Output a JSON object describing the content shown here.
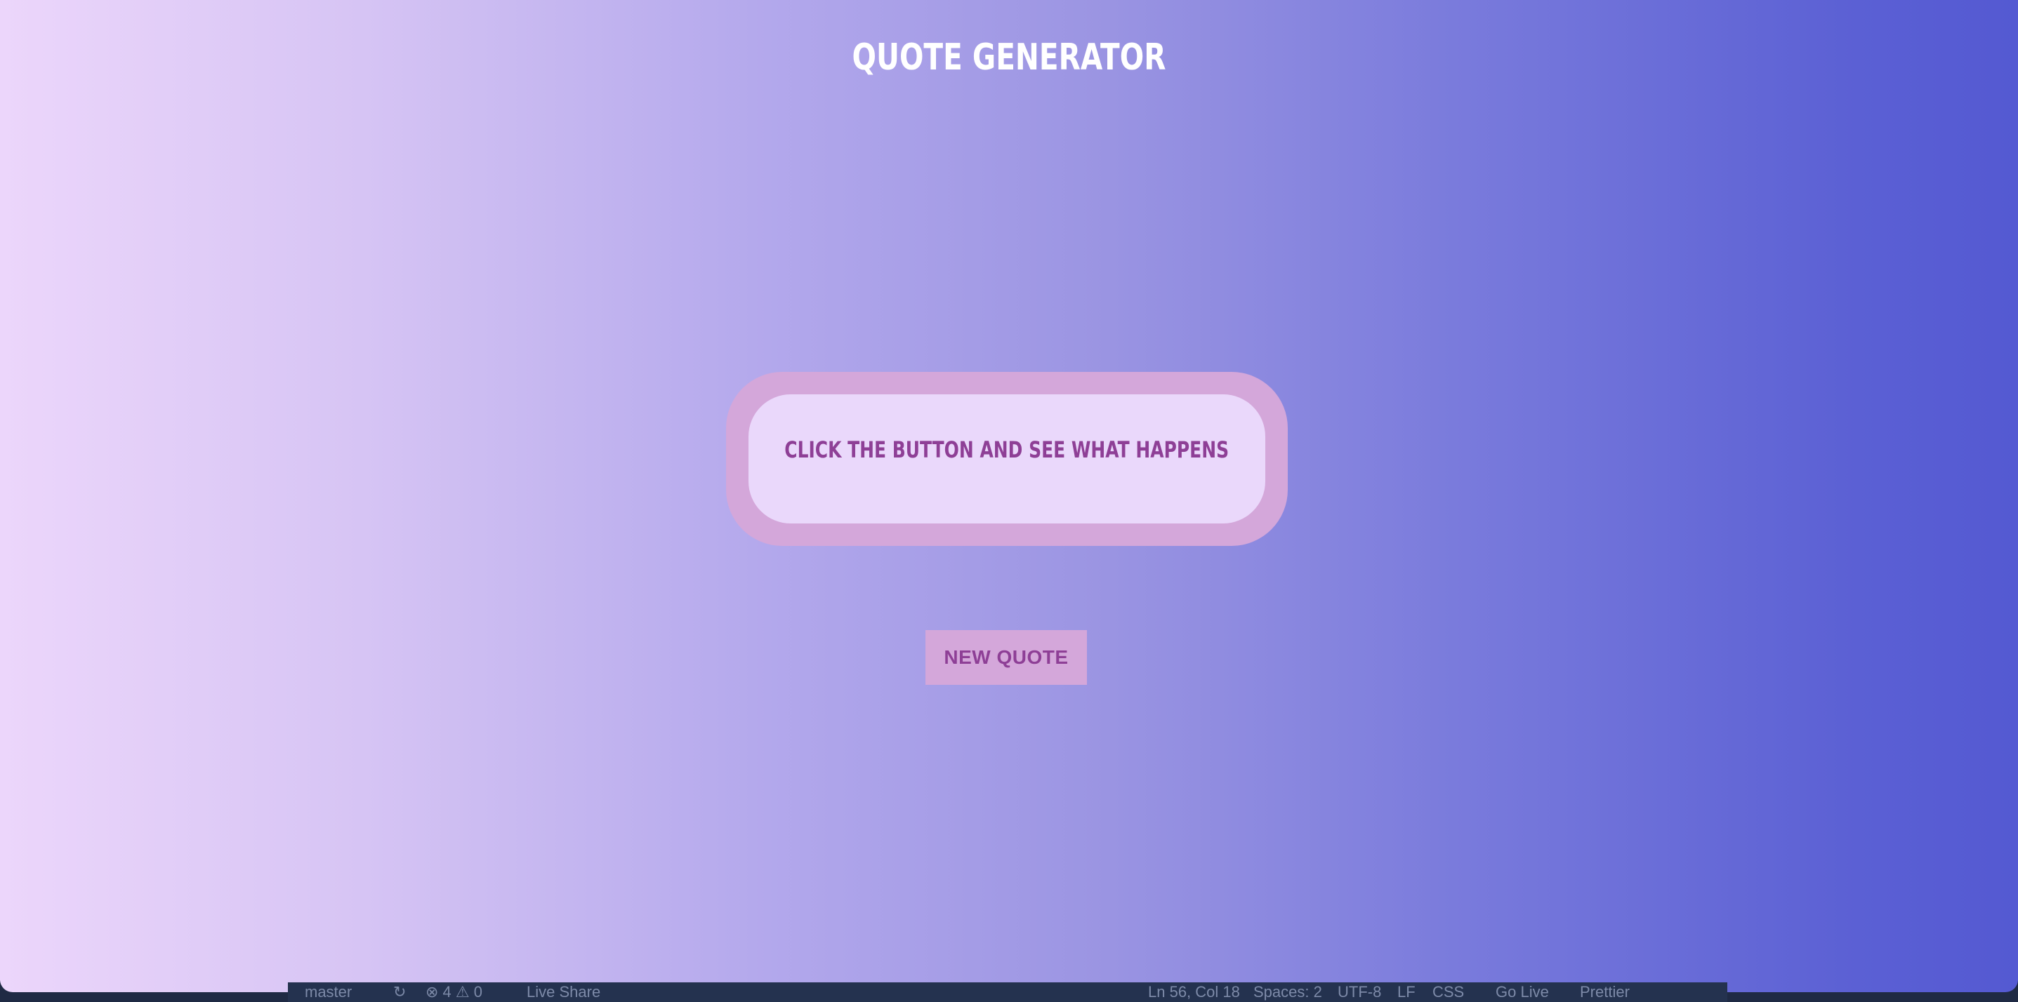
{
  "app": {
    "title": "QUOTE GENERATOR"
  },
  "quote": {
    "text": "CLICK THE BUTTON AND SEE WHAT HAPPENS"
  },
  "actions": {
    "new_quote_label": "NEW QUOTE"
  },
  "statusbar": {
    "branch": "master",
    "sync": "↻",
    "problems": "⊗ 4 ⚠ 0",
    "live_share": "Live Share",
    "cursor_position": "Ln 56, Col 18",
    "spaces": "Spaces: 2",
    "encoding": "UTF-8",
    "eol": "LF",
    "language": "CSS",
    "go_live": "Go Live",
    "prettier": "Prettier"
  },
  "colors": {
    "gradient_start": "#ecd6fb",
    "gradient_end": "#5459d2",
    "accent": "#d4a7da",
    "text_accent": "#8e3f96",
    "quote_bg": "#ead8fb"
  }
}
